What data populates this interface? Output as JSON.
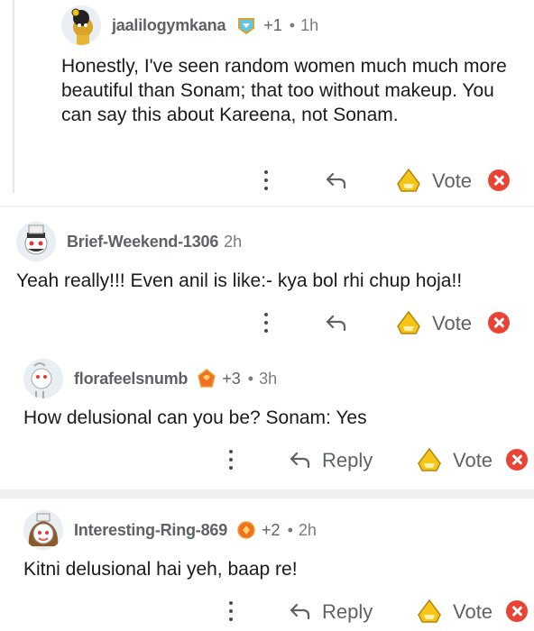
{
  "comments": [
    {
      "username": "jaalilogymkana",
      "award_count": "+1",
      "separator": "•",
      "time": "1h",
      "body": "Honestly, I've seen random women much much more beautiful than Sonam; that too without makeup. You can say this about Kareena, not Sonam.",
      "vote_label": "Vote",
      "reply_label": ""
    },
    {
      "username": "Brief-Weekend-1306",
      "award_count": "",
      "separator": "",
      "time": "2h",
      "body": "Yeah really!!! Even anil is like:- kya bol rhi chup hoja!!",
      "vote_label": "Vote",
      "reply_label": ""
    },
    {
      "username": "florafeelsnumb",
      "award_count": "+3",
      "separator": "•",
      "time": "3h",
      "body": "How delusional can you be? Sonam: Yes",
      "vote_label": "Vote",
      "reply_label": "Reply"
    },
    {
      "username": "Interesting-Ring-869",
      "award_count": "+2",
      "separator": "•",
      "time": "2h",
      "body": "Kitni delusional hai yeh, baap re!",
      "vote_label": "Vote",
      "reply_label": "Reply"
    }
  ],
  "colors": {
    "accent_vote": "#f5c518",
    "close_red": "#ea4335",
    "meta_gray": "#5c6266"
  },
  "icons": [
    "more-vertical-icon",
    "reply-arrow-icon",
    "vote-award-icon",
    "close-icon",
    "award-icon"
  ]
}
